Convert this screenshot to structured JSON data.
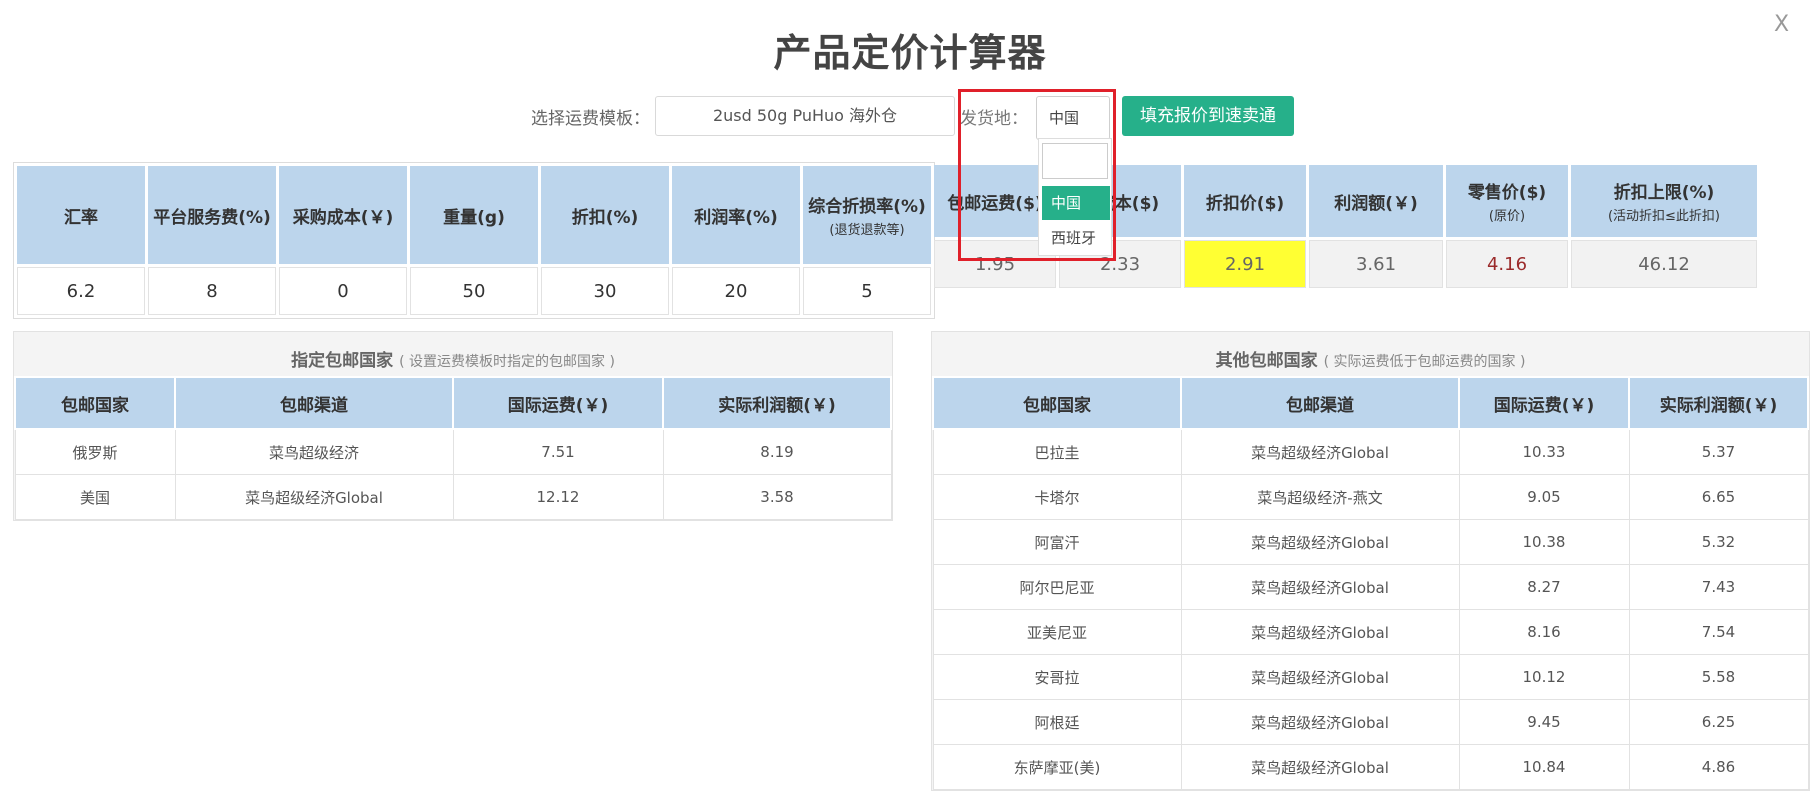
{
  "title": "产品定价计算器",
  "close_label": "X",
  "template": {
    "label": "选择运费模板：",
    "value": "2usd 50g PuHuo 海外仓"
  },
  "origin": {
    "label": "发货地：",
    "value": "中国",
    "options": [
      "中国",
      "西班牙"
    ]
  },
  "fill_button": "填充报价到速卖通",
  "inputs": {
    "headers": [
      {
        "main": "汇率",
        "sub": ""
      },
      {
        "main": "平台服务费(%)",
        "sub": ""
      },
      {
        "main": "采购成本(￥)",
        "sub": ""
      },
      {
        "main": "重量(g)",
        "sub": ""
      },
      {
        "main": "折扣(%)",
        "sub": ""
      },
      {
        "main": "利润率(%)",
        "sub": ""
      },
      {
        "main": "综合折损率(%)",
        "sub": "(退货退款等)"
      }
    ],
    "values": [
      "6.2",
      "8",
      "0",
      "50",
      "30",
      "20",
      "5"
    ]
  },
  "results": {
    "headers": [
      {
        "main": "包邮运费($)",
        "sub": ""
      },
      {
        "main": "总成本($)",
        "sub": ""
      },
      {
        "main": "折扣价($)",
        "sub": ""
      },
      {
        "main": "利润额(￥)",
        "sub": ""
      },
      {
        "main": "零售价($)",
        "sub": "(原价)"
      },
      {
        "main": "折扣上限(%)",
        "sub": "(活动折扣≤此折扣)"
      }
    ],
    "values": [
      "1.95",
      "2.33",
      "2.91",
      "3.61",
      "4.16",
      "46.12"
    ]
  },
  "designated": {
    "title": "指定包邮国家",
    "note": "( 设置运费模板时指定的包邮国家 )",
    "columns": [
      "包邮国家",
      "包邮渠道",
      "国际运费(￥)",
      "实际利润额(￥)"
    ],
    "rows": [
      [
        "俄罗斯",
        "菜鸟超级经济",
        "7.51",
        "8.19"
      ],
      [
        "美国",
        "菜鸟超级经济Global",
        "12.12",
        "3.58"
      ]
    ]
  },
  "others": {
    "title": "其他包邮国家",
    "note": "( 实际运费低于包邮运费的国家 )",
    "columns": [
      "包邮国家",
      "包邮渠道",
      "国际运费(￥)",
      "实际利润额(￥)"
    ],
    "rows": [
      [
        "巴拉圭",
        "菜鸟超级经济Global",
        "10.33",
        "5.37"
      ],
      [
        "卡塔尔",
        "菜鸟超级经济-燕文",
        "9.05",
        "6.65"
      ],
      [
        "阿富汗",
        "菜鸟超级经济Global",
        "10.38",
        "5.32"
      ],
      [
        "阿尔巴尼亚",
        "菜鸟超级经济Global",
        "8.27",
        "7.43"
      ],
      [
        "亚美尼亚",
        "菜鸟超级经济Global",
        "8.16",
        "7.54"
      ],
      [
        "安哥拉",
        "菜鸟超级经济Global",
        "10.12",
        "5.58"
      ],
      [
        "阿根廷",
        "菜鸟超级经济Global",
        "9.45",
        "6.25"
      ],
      [
        "东萨摩亚(美)",
        "菜鸟超级经济Global",
        "10.84",
        "4.86"
      ]
    ]
  }
}
